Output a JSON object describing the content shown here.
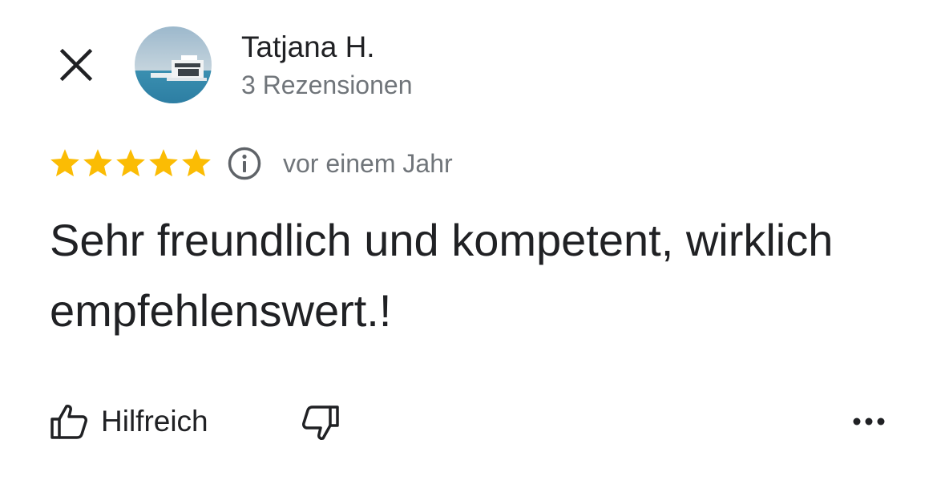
{
  "review": {
    "author": {
      "name": "Tatjana H.",
      "review_count": "3 Rezensionen"
    },
    "rating": 5,
    "rating_max": 5,
    "date": "vor einem Jahr",
    "text": "Sehr freundlich und kompetent, wirklich empfehlenswert.!"
  },
  "actions": {
    "helpful_label": "Hilfreich"
  },
  "icons": {
    "close": "close-icon",
    "info": "info-icon",
    "thumbs_up": "thumbs-up-icon",
    "thumbs_down": "thumbs-down-icon",
    "more": "more-horizontal-icon"
  },
  "colors": {
    "star": "#fbbc04",
    "text_primary": "#202124",
    "text_secondary": "#70757a"
  }
}
